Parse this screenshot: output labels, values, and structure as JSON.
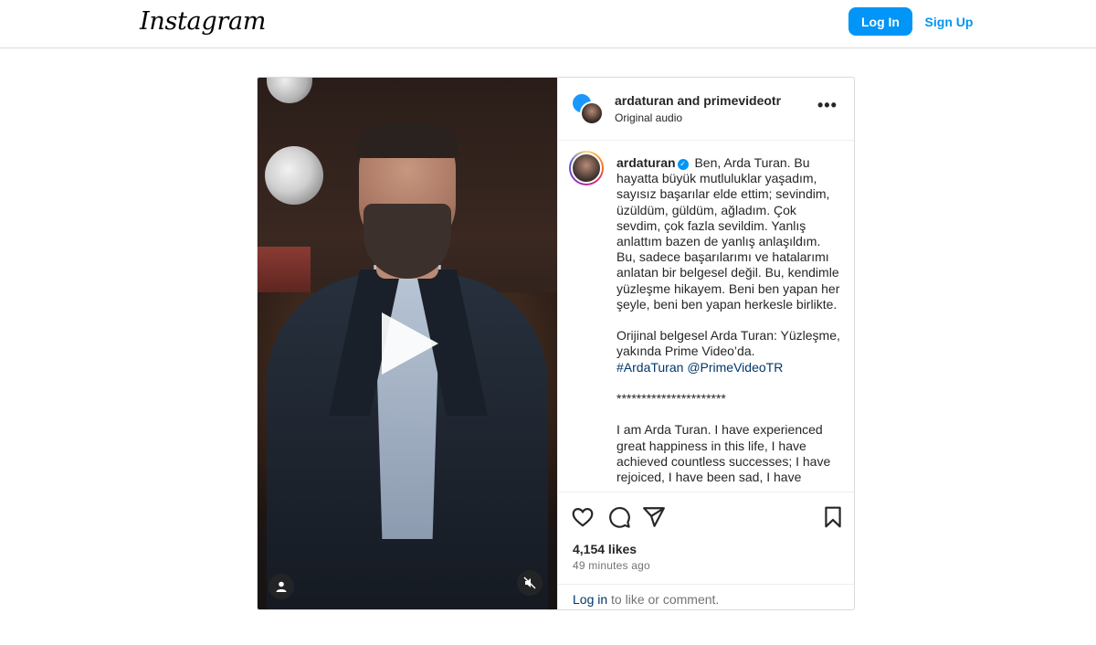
{
  "header": {
    "logo": "Instagram",
    "login_label": "Log In",
    "signup_label": "Sign Up"
  },
  "post": {
    "header_names": "ardaturan and primevideotr",
    "header_audio": "Original audio",
    "more_glyph": "•••",
    "caption_user": "ardaturan",
    "caption_main": " Ben, Arda Turan. Bu hayatta büyük mutluluklar yaşadım, sayısız başarılar elde ettim; sevindim, üzüldüm, güldüm, ağladım. Çok sevdim, çok fazla sevildim. Yanlış anlattım bazen de yanlış anlaşıldım. Bu, sadece başarılarımı ve hatalarımı anlatan bir belgesel değil. Bu, kendimle yüzleşme hikayem. Beni ben yapan her şeyle, beni ben yapan herkesle birlikte.\n\nOrijinal belgesel Arda Turan: Yüzleşme, yakında Prime Video’da.\n",
    "hashtag": "#ArdaTuran",
    "mention": "@PrimeVideoTR",
    "caption_tail": "\n\n**********************\n\nI am Arda Turan. I have experienced great happiness in this life, I have achieved countless successes; I have rejoiced, I have been sad, I have",
    "likes": "4,154 likes",
    "time": "49 minutes ago",
    "comment_login": "Log in",
    "comment_rest": " to like or comment."
  },
  "icons": {
    "like": "heart-icon",
    "comment": "comment-icon",
    "share": "share-icon",
    "save": "bookmark-icon",
    "tag": "user-tag-icon",
    "mute": "mute-icon",
    "play": "play-icon",
    "verified": "verified-badge-icon"
  },
  "colors": {
    "accent": "#0095f6",
    "link": "#00376b",
    "muted": "#737373",
    "border": "#dbdbdb"
  }
}
